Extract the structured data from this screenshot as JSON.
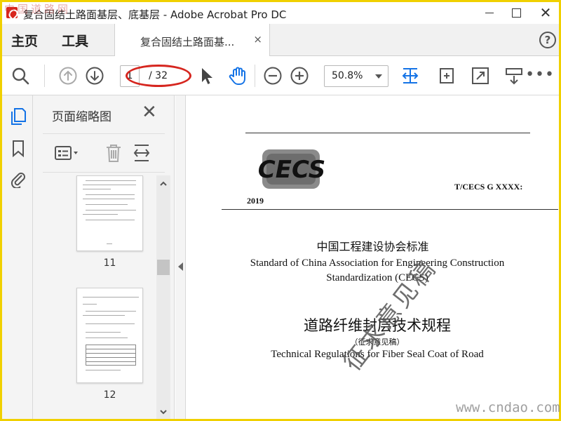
{
  "window": {
    "title": "复合固结土路面基层、底基层 - Adobe Acrobat Pro DC"
  },
  "tabs": {
    "home": "主页",
    "tools": "工具",
    "document": "复合固结土路面基...",
    "close_glyph": "×",
    "help_glyph": "?"
  },
  "toolbar": {
    "current_page": "1",
    "total_pages": "/ 32",
    "zoom": "50.8%",
    "more_glyph": "•••"
  },
  "thumbnail_panel": {
    "title": "页面缩略图",
    "close_glyph": "✕",
    "thumbnails": [
      {
        "page_label": "11"
      },
      {
        "page_label": "12"
      }
    ]
  },
  "document": {
    "logo_text": "CECS",
    "year": "2019",
    "standard_code": "T/CECS G XXXX:",
    "org_cn": "中国工程建设协会标准",
    "org_en_line1": "Standard of China Association for Engineering Construction",
    "org_en_line2": "Standardization (CECS)",
    "title_cn": "道路纤维封层技术规程",
    "draft_label": "（征求意见稿）",
    "title_en": "Technical Regulations for Fiber Seal Coat of Road",
    "draft_stamp": "征求意见稿"
  },
  "watermarks": {
    "top": "中国道路网",
    "bottom": "www.cndao.com"
  },
  "colors": {
    "accent_blue": "#1473e6",
    "annotation_red": "#d6261f",
    "frame_yellow": "#f0d000"
  },
  "icons": {
    "search": "search-icon",
    "prev_page": "arrow-up-circle-icon",
    "next_page": "arrow-down-circle-icon",
    "select": "cursor-arrow-icon",
    "hand": "hand-icon",
    "zoom_out": "minus-circle-icon",
    "zoom_in": "plus-circle-icon"
  }
}
